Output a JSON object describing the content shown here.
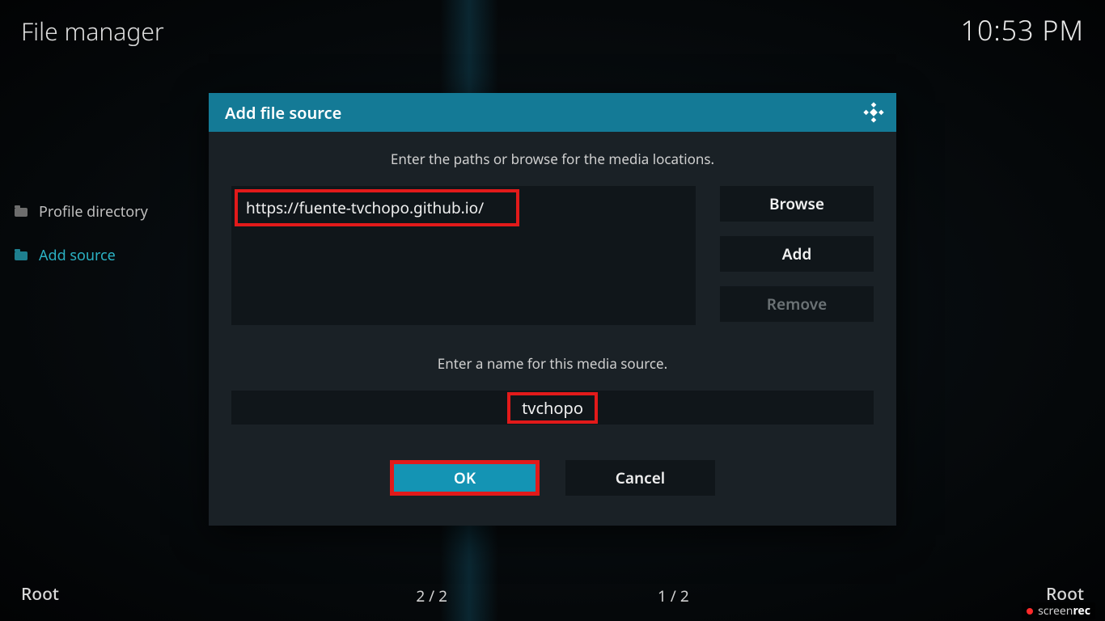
{
  "header": {
    "title": "File manager",
    "clock": "10:53 PM"
  },
  "sidebar": {
    "items": [
      {
        "label": "Profile directory",
        "active": false
      },
      {
        "label": "Add source",
        "active": true
      }
    ]
  },
  "dialog": {
    "title": "Add file source",
    "instruction_paths": "Enter the paths or browse for the media locations.",
    "path_value": "https://fuente-tvchopo.github.io/",
    "buttons": {
      "browse": "Browse",
      "add": "Add",
      "remove": "Remove"
    },
    "instruction_name": "Enter a name for this media source.",
    "name_value": "tvchopo",
    "ok_label": "OK",
    "cancel_label": "Cancel"
  },
  "footer": {
    "left": "Root",
    "right": "Root",
    "page_left": "2 / 2",
    "page_right": "1 / 2"
  },
  "watermark": {
    "brand1": "screen",
    "brand2": "rec"
  },
  "colors": {
    "accent": "#147a96",
    "highlight": "#e21a1a"
  }
}
